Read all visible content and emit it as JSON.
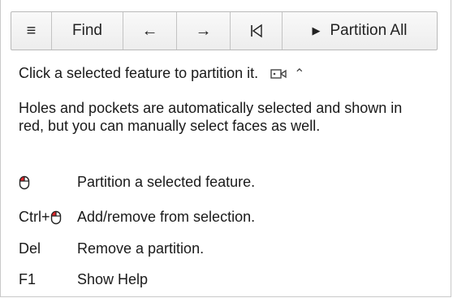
{
  "toolbar": {
    "menu_icon": "≡",
    "find_label": "Find",
    "back_icon": "←",
    "forward_icon": "→",
    "first_icon": "⏮",
    "partition_all_label": "Partition All",
    "play_icon": "▶"
  },
  "instruction": {
    "text": "Click a selected feature to partition it.",
    "camera_icon": "camera-icon",
    "collapse_icon": "⌃"
  },
  "help_text": "Holes and pockets are automatically selected and shown in red, but you can manually select faces as well.",
  "shortcuts": [
    {
      "key": "",
      "icon": "mouse-left-click-icon",
      "description": "Partition a selected feature."
    },
    {
      "key": "Ctrl+",
      "icon": "mouse-left-click-icon",
      "description": "Add/remove from selection."
    },
    {
      "key": "Del",
      "icon": "",
      "description": "Remove a partition."
    },
    {
      "key": "F1",
      "icon": "",
      "description": "Show Help"
    }
  ],
  "colors": {
    "mouse_highlight": "#e0262b",
    "toolbar_border": "#b9b9b9"
  }
}
